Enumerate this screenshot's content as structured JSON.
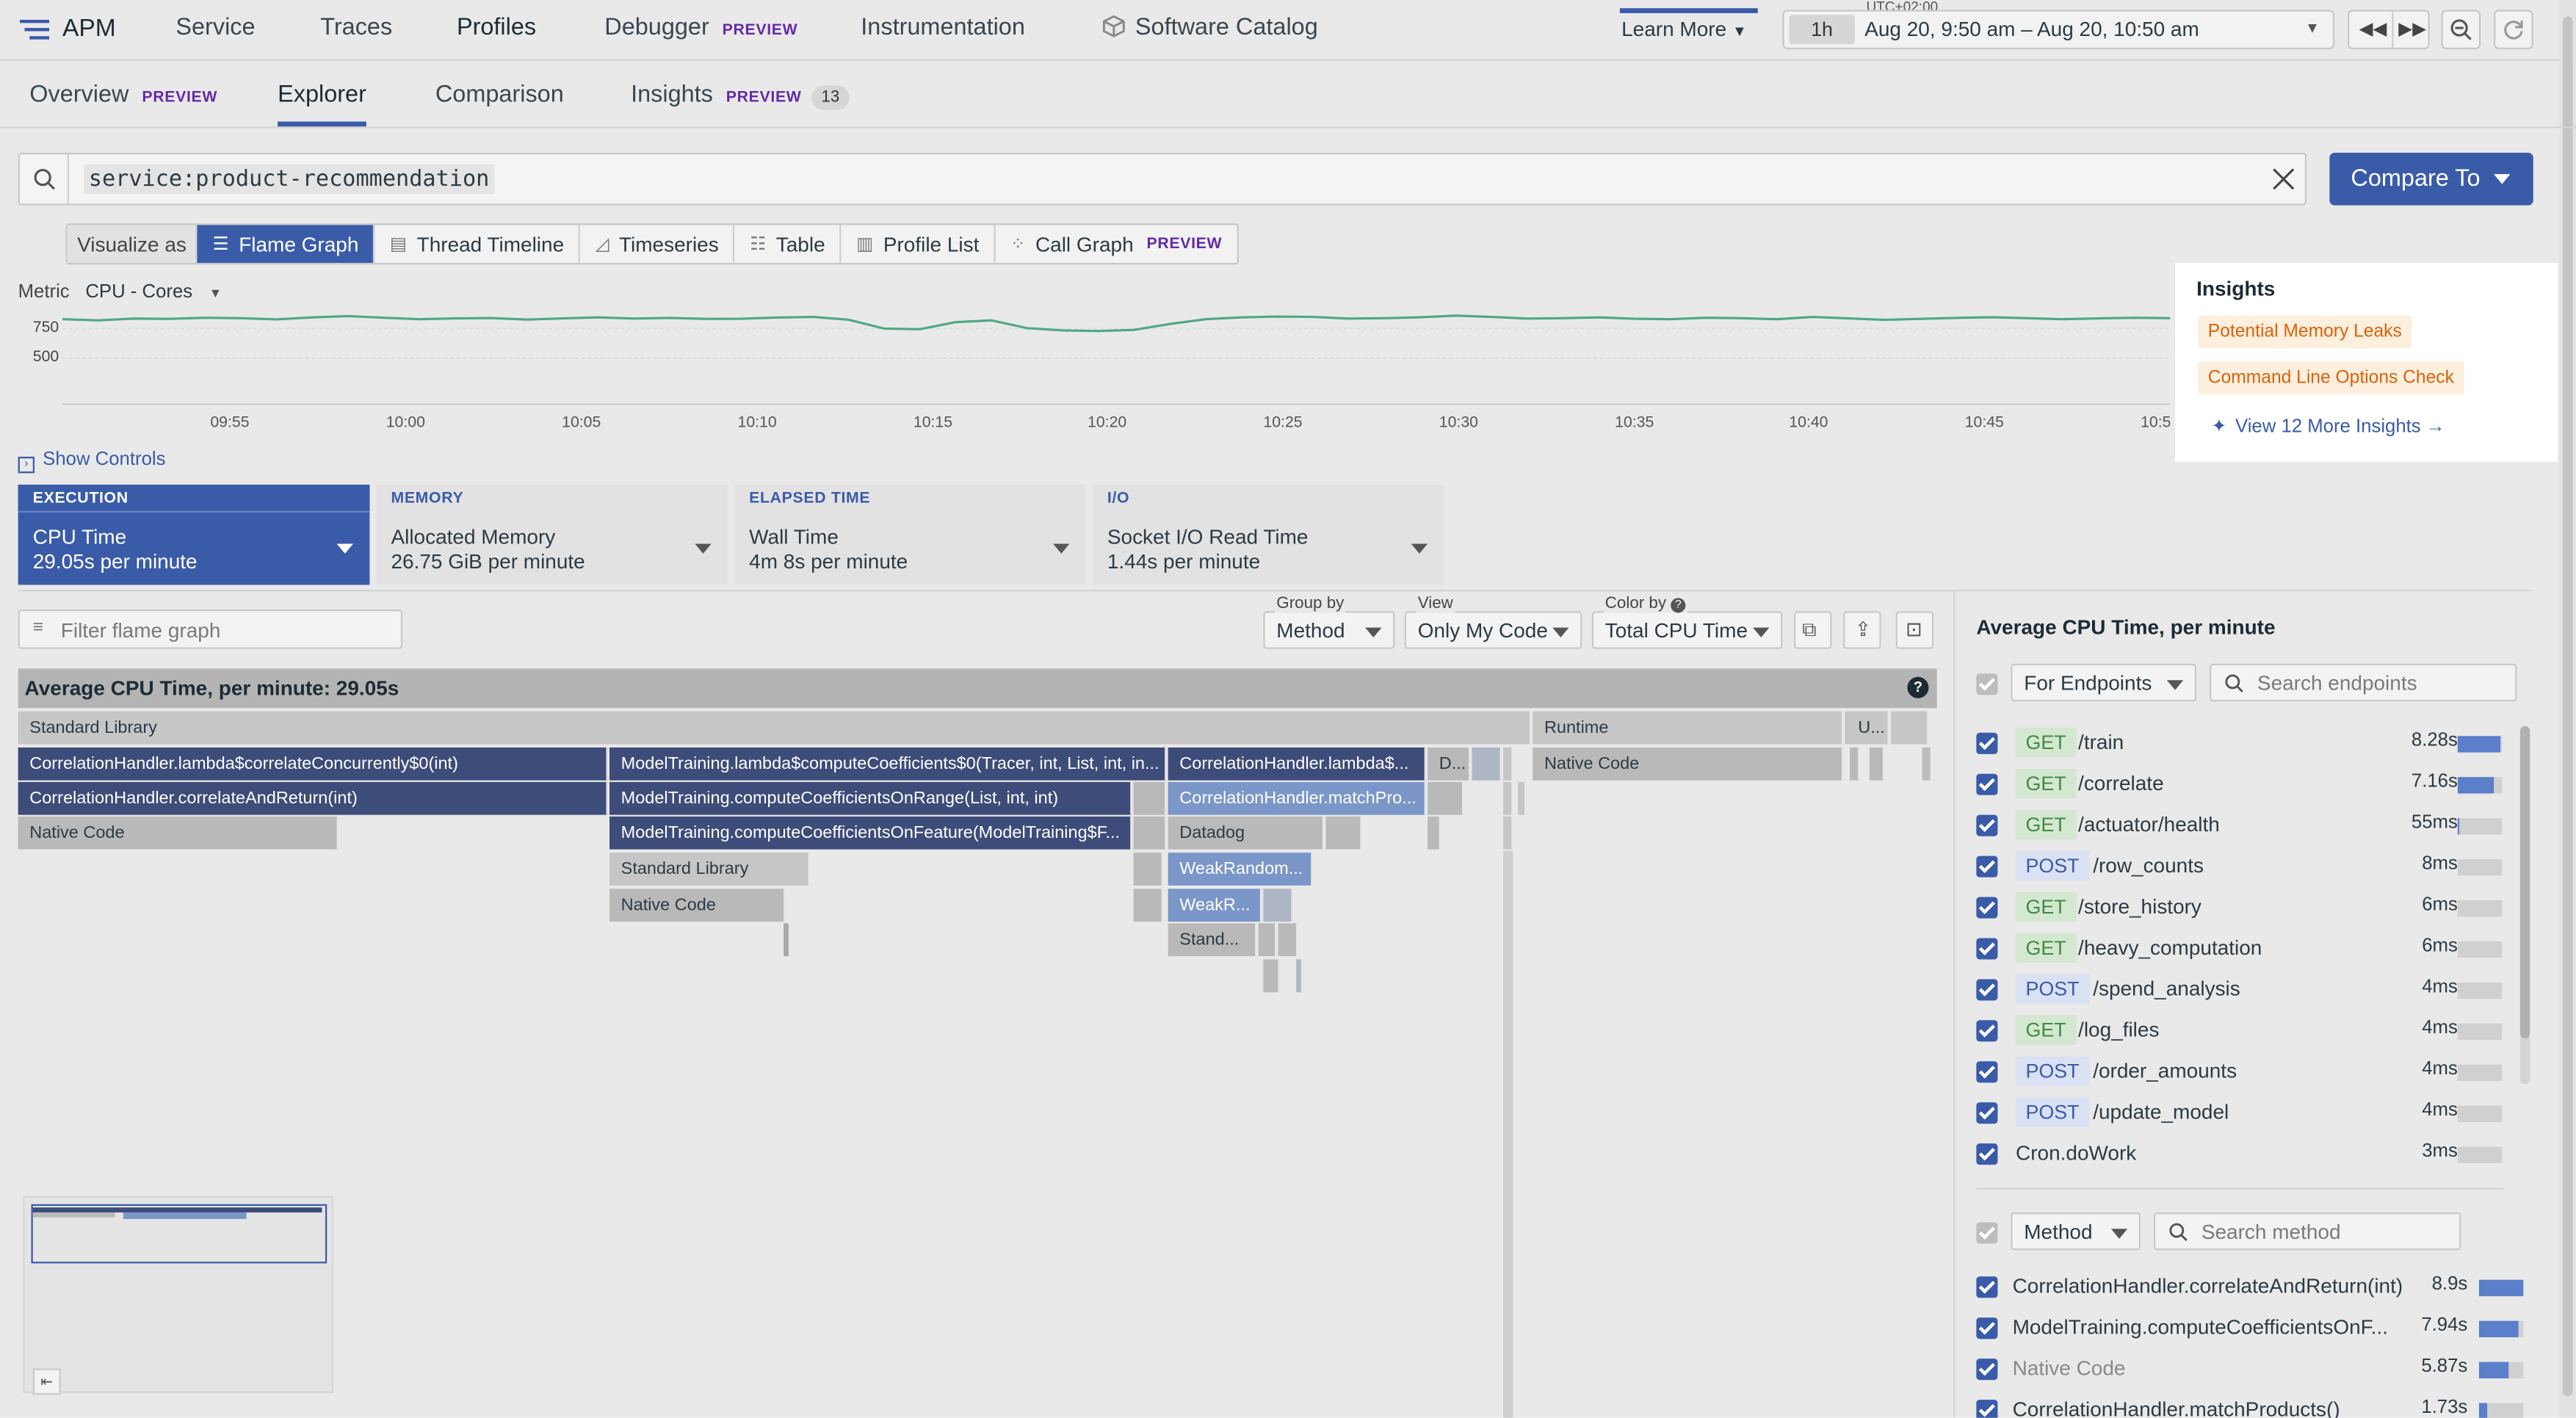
{
  "nav": {
    "logo": "APM",
    "items": [
      "Service",
      "Traces",
      "Profiles",
      "Debugger",
      "Instrumentation",
      "Software Catalog"
    ],
    "debugger_badge": "PREVIEW",
    "learn_more": "Learn More",
    "timezone": "UTC+02:00",
    "range_short": "1h",
    "range": "Aug 20, 9:50 am – Aug 20, 10:50 am"
  },
  "subnav": {
    "overview": "Overview",
    "overview_badge": "PREVIEW",
    "explorer": "Explorer",
    "comparison": "Comparison",
    "insights": "Insights",
    "insights_badge": "PREVIEW",
    "insights_count": "13"
  },
  "search": {
    "query": "service:product-recommendation",
    "compare": "Compare To"
  },
  "visualize": {
    "label": "Visualize as",
    "options": [
      "Flame Graph",
      "Thread Timeline",
      "Timeseries",
      "Table",
      "Profile List",
      "Call Graph"
    ],
    "call_graph_badge": "PREVIEW",
    "selected": "Flame Graph"
  },
  "metric": {
    "label": "Metric",
    "value": "CPU - Cores",
    "y_ticks": [
      "750",
      "500"
    ],
    "x_ticks": [
      "09:55",
      "10:00",
      "10:05",
      "10:10",
      "10:15",
      "10:20",
      "10:25",
      "10:30",
      "10:35",
      "10:40",
      "10:45",
      "10:5"
    ],
    "series_color": "#4fa883"
  },
  "chart_data": {
    "type": "line",
    "ylabel": "",
    "ylim": [
      0,
      800
    ],
    "x": [
      "09:51",
      "09:52",
      "09:53",
      "09:54",
      "09:55",
      "09:56",
      "09:57",
      "09:58",
      "09:59",
      "10:00",
      "10:01",
      "10:02",
      "10:03",
      "10:04",
      "10:05",
      "10:06",
      "10:07",
      "10:08",
      "10:09",
      "10:10",
      "10:11",
      "10:12",
      "10:13",
      "10:14",
      "10:15",
      "10:16",
      "10:17",
      "10:18",
      "10:19",
      "10:20",
      "10:21",
      "10:22",
      "10:23",
      "10:24",
      "10:25",
      "10:26",
      "10:27",
      "10:28",
      "10:29",
      "10:30",
      "10:31",
      "10:32",
      "10:33",
      "10:34",
      "10:35",
      "10:36",
      "10:37",
      "10:38",
      "10:39",
      "10:40",
      "10:41",
      "10:42",
      "10:43",
      "10:44",
      "10:45",
      "10:46",
      "10:47",
      "10:48",
      "10:49",
      "10:50"
    ],
    "series": [
      {
        "values": [
          700,
          690,
          705,
          702,
          712,
          708,
          698,
          715,
          725,
          712,
          700,
          706,
          709,
          696,
          706,
          715,
          705,
          710,
          702,
          704,
          713,
          718,
          695,
          620,
          615,
          675,
          690,
          625,
          605,
          600,
          610,
          660,
          700,
          715,
          722,
          718,
          705,
          708,
          716,
          730,
          718,
          705,
          708,
          715,
          704,
          700,
          712,
          708,
          700,
          718,
          706,
          694,
          702,
          710,
          716,
          708,
          700,
          706,
          712,
          708
        ]
      }
    ]
  },
  "insights_card": {
    "title": "Insights",
    "items": [
      "Potential Memory Leaks",
      "Command Line Options Check"
    ],
    "more": "View 12 More Insights →"
  },
  "show_controls": "Show Controls",
  "metric_cards": [
    {
      "head": "EXECUTION",
      "title": "CPU Time",
      "value": "29.05s per minute"
    },
    {
      "head": "MEMORY",
      "title": "Allocated Memory",
      "value": "26.75 GiB per minute"
    },
    {
      "head": "ELAPSED TIME",
      "title": "Wall Time",
      "value": "4m 8s per minute"
    },
    {
      "head": "I/O",
      "title": "Socket I/O Read Time",
      "value": "1.44s per minute"
    }
  ],
  "flame": {
    "filter_placeholder": "Filter flame graph",
    "group_label": "Group by",
    "group_value": "Method",
    "view_label": "View",
    "view_value": "Only My Code",
    "color_label": "Color by",
    "color_value": "Total CPU Time",
    "header": "Average CPU Time, per minute: 29.05s",
    "frames": {
      "stdlib": "Standard Library",
      "runtime": "Runtime",
      "u": "U...",
      "f1": "CorrelationHandler.lambda$correlateConcurrently$0(int)",
      "f2": "ModelTraining.lambda$computeCoefficients$0(Tracer, int, List, int, in...",
      "f3": "CorrelationHandler.lambda$...",
      "f4": "D...",
      "native": "Native Code",
      "f5": "CorrelationHandler.correlateAndReturn(int)",
      "f6": "ModelTraining.computeCoefficientsOnRange(List, int, int)",
      "f7": "CorrelationHandler.matchPro...",
      "f8": "ModelTraining.computeCoefficientsOnFeature(ModelTraining$F...",
      "f9": "Datadog",
      "f10": "WeakRandom...",
      "f11": "WeakR...",
      "f12": "Stand..."
    }
  },
  "right_panel": {
    "title": "Average CPU Time, per minute",
    "endpoint_filter": "For Endpoints",
    "endpoint_search": "Search endpoints",
    "endpoints": [
      {
        "method": "GET",
        "path": "/train",
        "value": "8.28s",
        "fill": 0.95
      },
      {
        "method": "GET",
        "path": "/correlate",
        "value": "7.16s",
        "fill": 0.82
      },
      {
        "method": "GET",
        "path": "/actuator/health",
        "value": "55ms",
        "fill": 0.02
      },
      {
        "method": "POST",
        "path": "/row_counts",
        "value": "8ms",
        "fill": 0
      },
      {
        "method": "GET",
        "path": "/store_history",
        "value": "6ms",
        "fill": 0
      },
      {
        "method": "GET",
        "path": "/heavy_computation",
        "value": "6ms",
        "fill": 0
      },
      {
        "method": "POST",
        "path": "/spend_analysis",
        "value": "4ms",
        "fill": 0
      },
      {
        "method": "GET",
        "path": "/log_files",
        "value": "4ms",
        "fill": 0
      },
      {
        "method": "POST",
        "path": "/order_amounts",
        "value": "4ms",
        "fill": 0
      },
      {
        "method": "POST",
        "path": "/update_model",
        "value": "4ms",
        "fill": 0
      },
      {
        "method": "",
        "path": "Cron.doWork",
        "value": "3ms",
        "fill": 0
      }
    ],
    "method_filter": "Method",
    "method_search": "Search method",
    "methods": [
      {
        "name": "CorrelationHandler.correlateAndReturn(int)",
        "value": "8.9s",
        "fill": 1.0,
        "muted": false
      },
      {
        "name": "ModelTraining.computeCoefficientsOnF...",
        "value": "7.94s",
        "fill": 0.9,
        "muted": false
      },
      {
        "name": "Native Code",
        "value": "5.87s",
        "fill": 0.66,
        "muted": true
      },
      {
        "name": "CorrelationHandler.matchProducts()",
        "value": "1.73s",
        "fill": 0.2,
        "muted": false
      }
    ]
  }
}
